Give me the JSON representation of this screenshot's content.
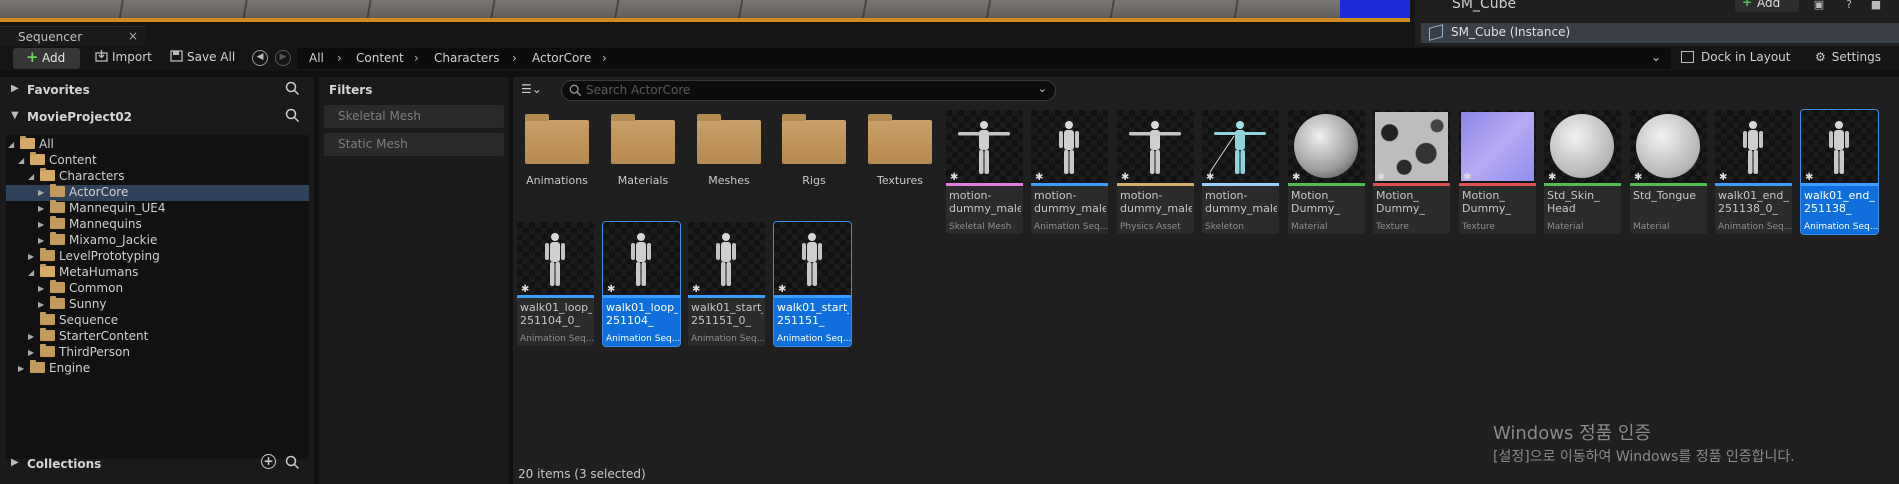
{
  "viewport": {
    "details_title": "SM_Cube",
    "add_label": "Add",
    "instance_label": "SM_Cube (Instance)"
  },
  "sequencer_tab": {
    "label": "Sequencer",
    "close": "×"
  },
  "toolbar": {
    "add_label": "Add",
    "import_label": "Import",
    "save_all_label": "Save All",
    "breadcrumb": [
      "All",
      "Content",
      "Characters",
      "ActorCore"
    ],
    "dock_label": "Dock in Layout",
    "settings_label": "Settings"
  },
  "left_panel": {
    "favorites_label": "Favorites",
    "project_label": "MovieProject02",
    "tree": [
      {
        "label": "All",
        "depth": 0,
        "expanded": true
      },
      {
        "label": "Content",
        "depth": 1,
        "expanded": true
      },
      {
        "label": "Characters",
        "depth": 2,
        "expanded": true
      },
      {
        "label": "ActorCore",
        "depth": 3,
        "expanded": false,
        "selected": true
      },
      {
        "label": "Mannequin_UE4",
        "depth": 3,
        "expanded": false
      },
      {
        "label": "Mannequins",
        "depth": 3,
        "expanded": false
      },
      {
        "label": "Mixamo_Jackie",
        "depth": 3,
        "expanded": false
      },
      {
        "label": "LevelPrototyping",
        "depth": 2,
        "expanded": false
      },
      {
        "label": "MetaHumans",
        "depth": 2,
        "expanded": true
      },
      {
        "label": "Common",
        "depth": 3,
        "expanded": false
      },
      {
        "label": "Sunny",
        "depth": 3,
        "expanded": false
      },
      {
        "label": "Sequence",
        "depth": 2,
        "expanded": null
      },
      {
        "label": "StarterContent",
        "depth": 2,
        "expanded": false
      },
      {
        "label": "ThirdPerson",
        "depth": 2,
        "expanded": false
      },
      {
        "label": "Engine",
        "depth": 1,
        "expanded": false
      }
    ],
    "collections_label": "Collections"
  },
  "filters": {
    "title": "Filters",
    "chips": [
      "Skeletal Mesh",
      "Static Mesh"
    ]
  },
  "content": {
    "search_placeholder": "Search ActorCore",
    "folders": [
      "Animations",
      "Materials",
      "Meshes",
      "Rigs",
      "Textures"
    ],
    "assets": [
      {
        "name": "motion-dummy_male",
        "type": "Skeletal Mesh",
        "color": "#e07fe0",
        "thumb": "figure",
        "selected": false
      },
      {
        "name": "motion-dummy_male",
        "type": "Animation Seq...",
        "color": "#3aa0ff",
        "thumb": "figure",
        "selected": false
      },
      {
        "name": "motion-dummy_male",
        "type": "Physics Asset",
        "color": "#d6b06a",
        "thumb": "figure",
        "selected": false
      },
      {
        "name": "motion-dummy_male",
        "type": "Skeleton",
        "color": "#9ad0ff",
        "thumb": "skeleton",
        "selected": false
      },
      {
        "name": "Motion_ Dummy_",
        "type": "Material",
        "color": "#4fbf4f",
        "thumb": "sphere-dark",
        "selected": false
      },
      {
        "name": "Motion_ Dummy_",
        "type": "Texture",
        "color": "#e05050",
        "thumb": "texture",
        "selected": false
      },
      {
        "name": "Motion_ Dummy_",
        "type": "Texture",
        "color": "#e05050",
        "thumb": "normal",
        "selected": false
      },
      {
        "name": "Std_Skin_ Head",
        "type": "Material",
        "color": "#4fbf4f",
        "thumb": "sphere",
        "selected": false
      },
      {
        "name": "Std_Tongue",
        "type": "Material",
        "color": "#4fbf4f",
        "thumb": "sphere",
        "selected": false
      },
      {
        "name": "walk01_end_ 251138_0_",
        "type": "Animation Seq...",
        "color": "#3aa0ff",
        "thumb": "figure",
        "selected": false
      },
      {
        "name": "walk01_end_ 251138_",
        "type": "Animation Seq...",
        "color": "#3aa0ff",
        "thumb": "figure",
        "selected": true
      },
      {
        "name": "walk01_loop_ 251104_0_",
        "type": "Animation Seq...",
        "color": "#3aa0ff",
        "thumb": "figure",
        "selected": false
      },
      {
        "name": "walk01_loop_ 251104_",
        "type": "Animation Seq...",
        "color": "#3aa0ff",
        "thumb": "figure",
        "selected": true
      },
      {
        "name": "walk01_start_ 251151_0_",
        "type": "Animation Seq...",
        "color": "#3aa0ff",
        "thumb": "figure",
        "selected": false
      },
      {
        "name": "walk01_start_ 251151_",
        "type": "Animation Seq...",
        "color": "#3aa0ff",
        "thumb": "figure",
        "selected": true
      }
    ],
    "status": "20 items (3 selected)"
  },
  "watermark": {
    "line1": "Windows 정품 인증",
    "line2": "[설정]으로 이동하여 Windows를 정품 인증합니다."
  }
}
